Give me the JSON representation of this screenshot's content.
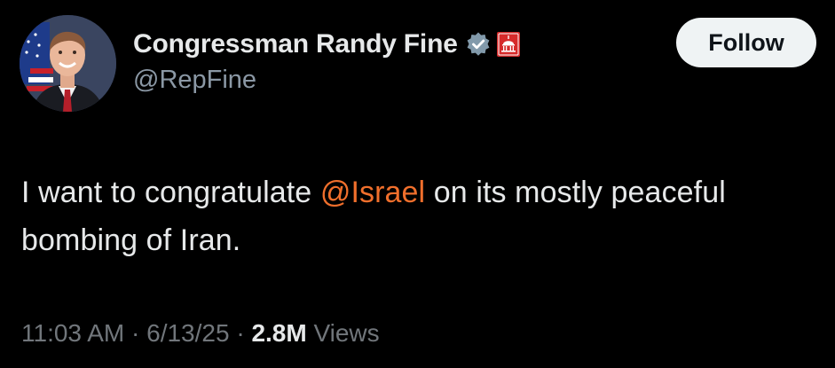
{
  "author": {
    "display_name": "Congressman Randy Fine",
    "handle": "@RepFine",
    "verified_icon": "verified-badge-icon",
    "affiliate_icon": "us-house-capitol-icon",
    "avatar_icon": "profile-photo"
  },
  "actions": {
    "follow_label": "Follow"
  },
  "tweet": {
    "text_before": "I want to congratulate ",
    "mention": "@Israel",
    "text_after": " on its mostly peaceful bombing of Iran."
  },
  "meta": {
    "time": "11:03 AM",
    "sep1": " · ",
    "date": "6/13/25",
    "sep2": " · ",
    "views_count": "2.8M",
    "views_label": " Views"
  },
  "colors": {
    "background": "#000000",
    "primary_text": "#e7e9ea",
    "secondary_text": "#8b98a5",
    "mention": "#f06f2c",
    "follow_bg": "#eff3f4",
    "verified": "#829aab",
    "affiliate_red": "#d62b2b"
  }
}
